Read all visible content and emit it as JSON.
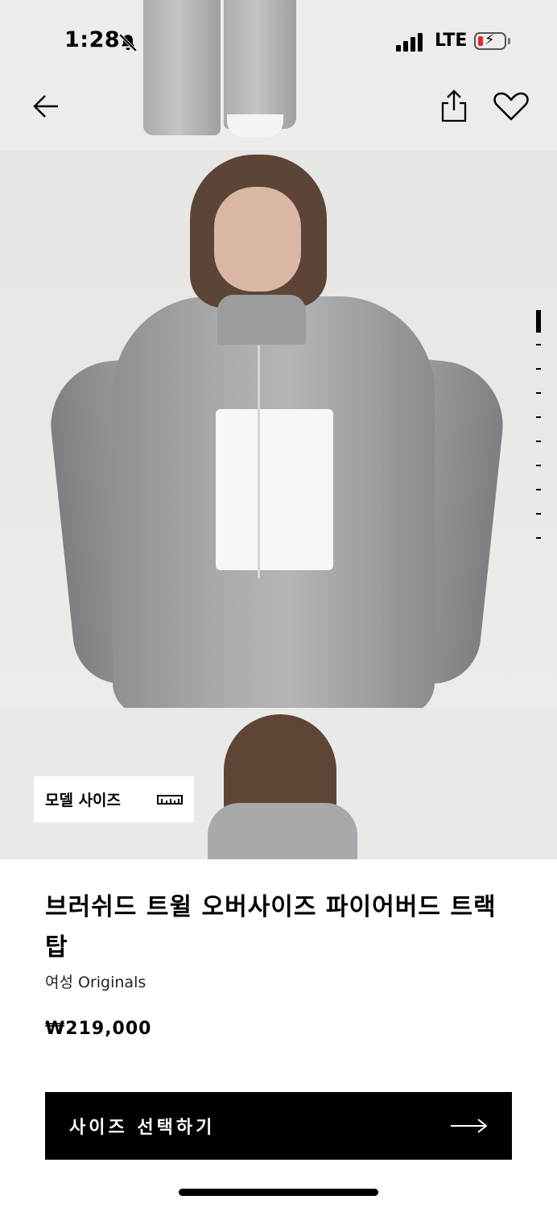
{
  "status_bar": {
    "time": "1:28",
    "network": "LTE",
    "battery_level": 0.12,
    "battery_color": "#e8262c"
  },
  "nav": {
    "back_icon": "arrow-left-icon",
    "share_icon": "share-icon",
    "wishlist_icon": "heart-icon"
  },
  "gallery": {
    "image_count": 10,
    "active_index": 1
  },
  "model_size": {
    "label": "모델 사이즈",
    "icon": "ruler-icon"
  },
  "product": {
    "title": "브러쉬드 트윌 오버사이즈 파이어버드 트랙 탑",
    "subtitle": "여성 Originals",
    "price": "₩219,000"
  },
  "cta": {
    "label": "사이즈 선택하기",
    "icon": "arrow-right-icon"
  }
}
